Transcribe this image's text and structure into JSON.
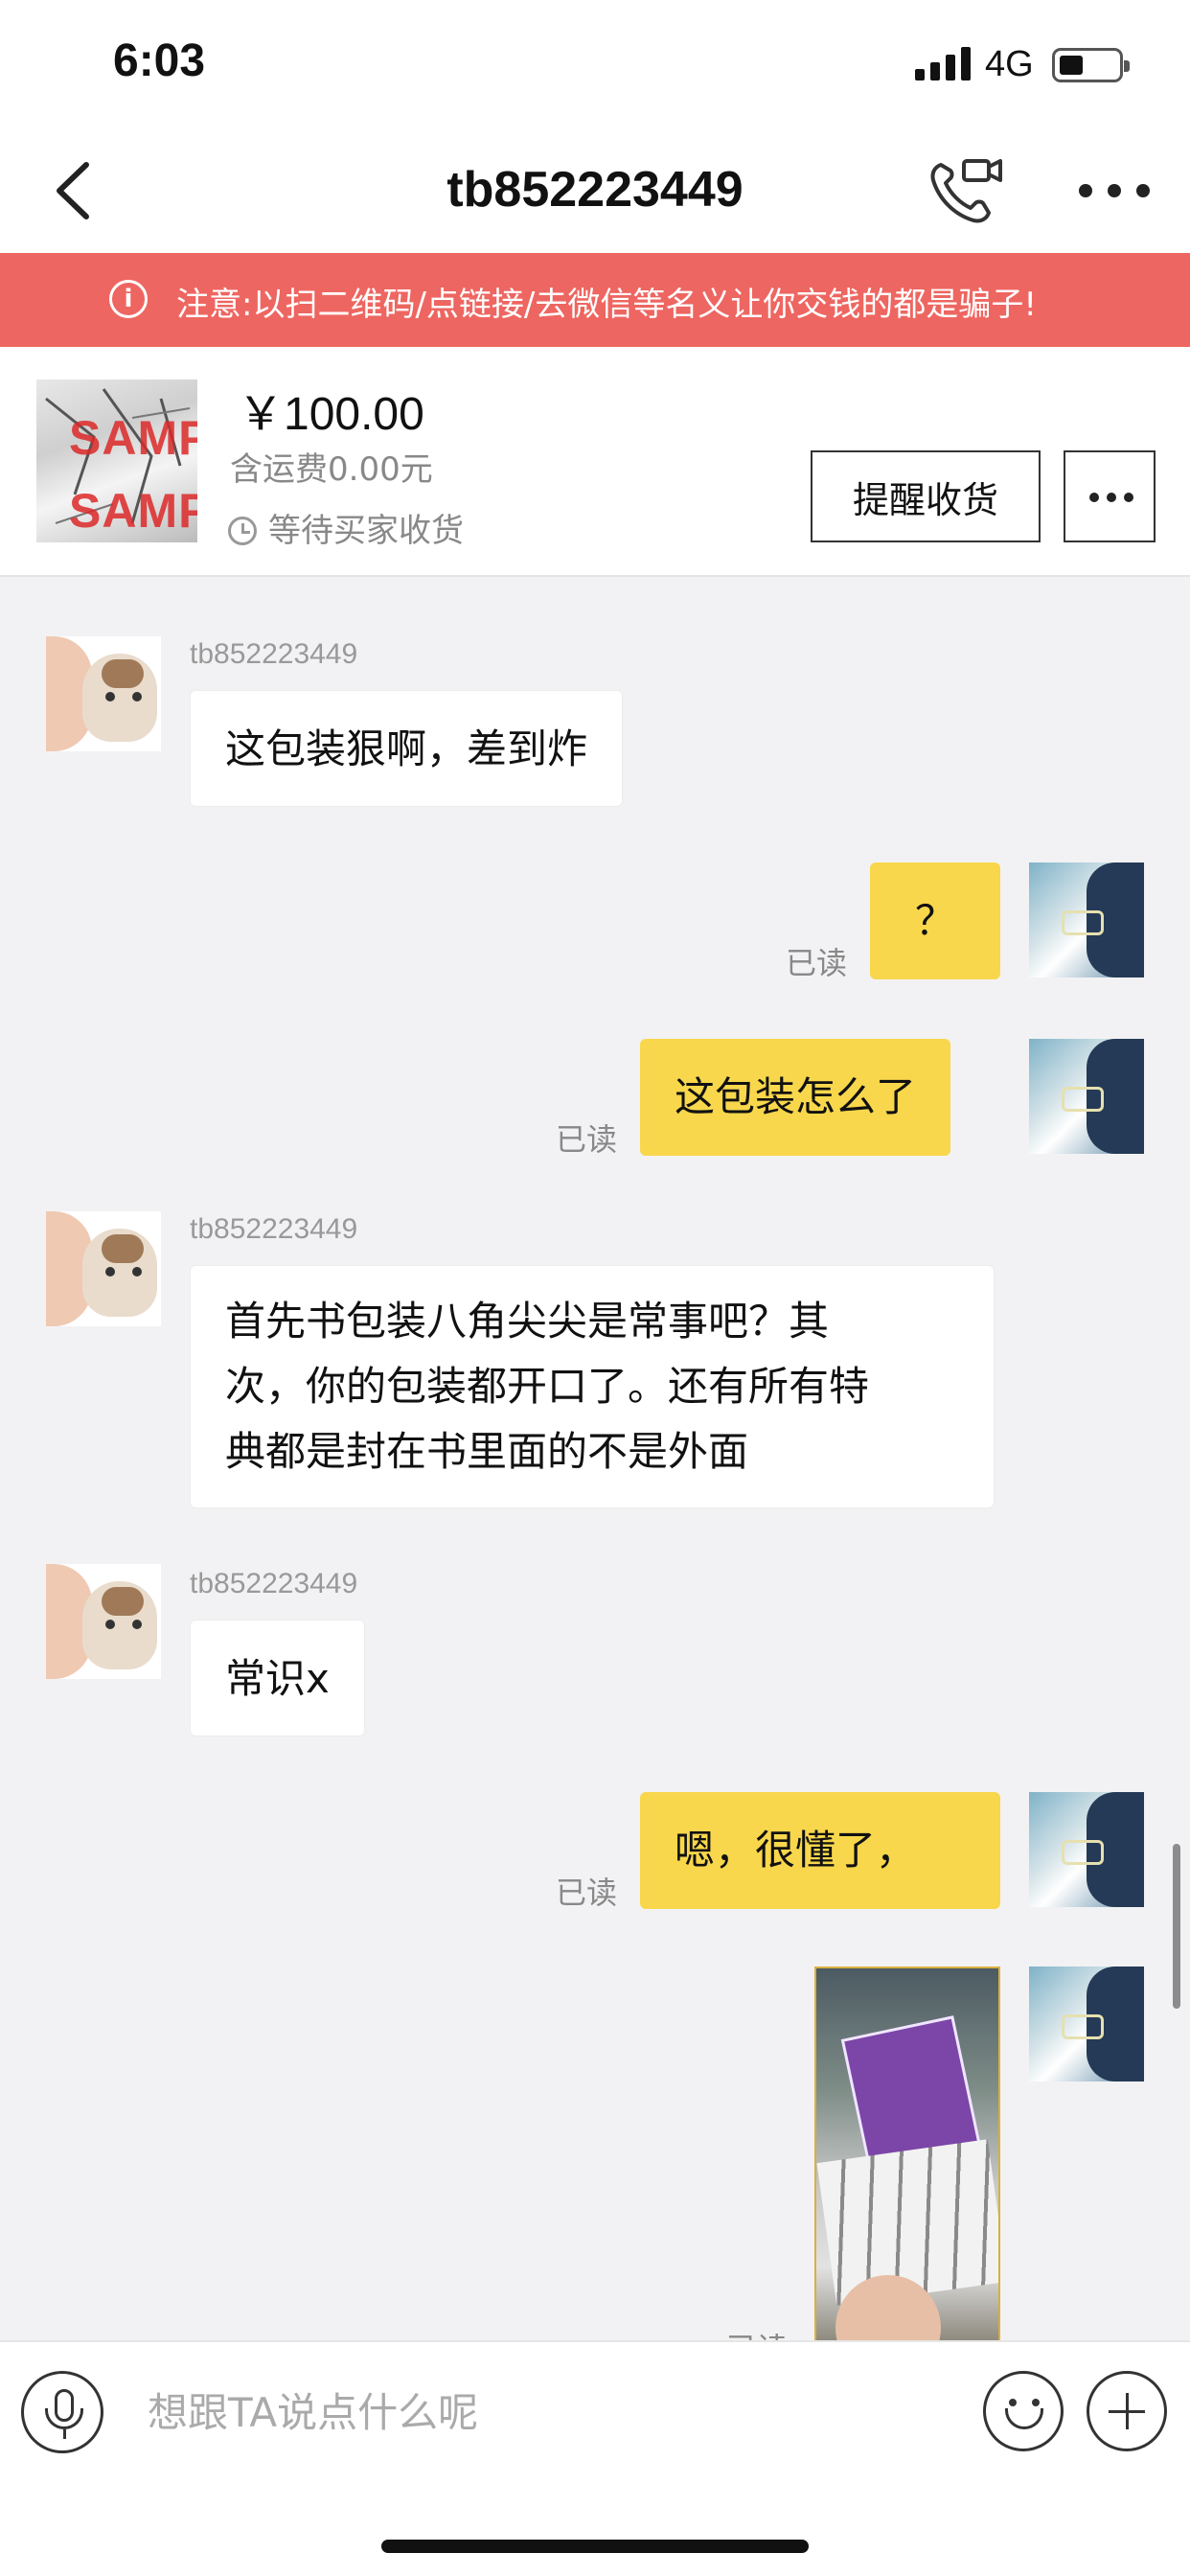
{
  "status_bar": {
    "time": "6:03",
    "network": "4G",
    "battery_level": 0.3
  },
  "nav": {
    "title": "tb852223449"
  },
  "warning": {
    "text": "注意:以扫二维码/点链接/去微信等名义让你交钱的都是骗子!"
  },
  "order": {
    "thumbnail_text": "SAMPLE",
    "price": "￥100.00",
    "shipping": "含运费0.00元",
    "status": "等待买家收货",
    "remind_label": "提醒收货"
  },
  "messages": [
    {
      "side": "incoming",
      "sender": "tb852223449",
      "text": "这包装狠啊，差到炸"
    },
    {
      "side": "outgoing",
      "text": "？",
      "read": "已读"
    },
    {
      "side": "outgoing",
      "text": "这包装怎么了",
      "read": "已读"
    },
    {
      "side": "incoming",
      "sender": "tb852223449",
      "text": "首先书包装八角尖尖是常事吧？其\n次，你的包装都开口了。还有所有特\n典都是封在书里面的不是外面"
    },
    {
      "side": "incoming",
      "sender": "tb852223449",
      "text": "常识x"
    },
    {
      "side": "outgoing",
      "text": "嗯，很懂了，",
      "read": "已读"
    },
    {
      "side": "outgoing",
      "type": "image",
      "read": "已读"
    }
  ],
  "input": {
    "placeholder": "想跟TA说点什么呢"
  },
  "icons": [
    "back-icon",
    "video-call-icon",
    "more-icon",
    "info-icon",
    "clock-icon",
    "mic-icon",
    "emoji-icon",
    "plus-icon"
  ],
  "colors": {
    "warning_bg": "#ee6661",
    "outgoing_bubble": "#f8d74c",
    "incoming_bubble": "#ffffff",
    "background": "#f2f2f4"
  }
}
